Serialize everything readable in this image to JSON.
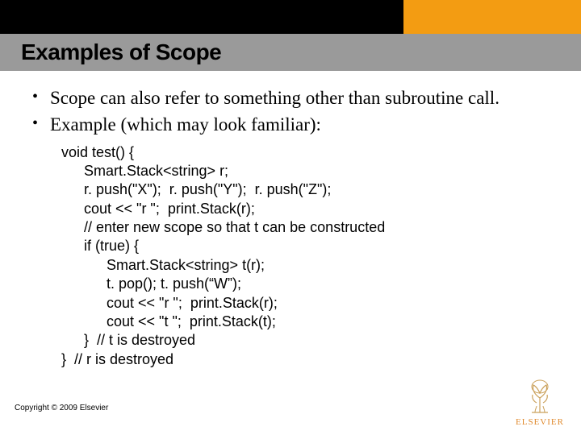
{
  "title": "Examples of Scope",
  "bullets": [
    "Scope can also refer to something other than subroutine call.",
    "Example (which may look familiar):"
  ],
  "code": {
    "l0": "void test() {",
    "l1": "Smart.Stack<string> r;",
    "l2": "r. push(\"X\");  r. push(\"Y\");  r. push(\"Z\");",
    "l3": "cout << \"r \";  print.Stack(r);",
    "l4": "// enter new scope so that t can be constructed",
    "l5": "if (true) {",
    "l6": "Smart.Stack<string> t(r);",
    "l7": "t. pop(); t. push(“W”);",
    "l8": "cout << \"r \";  print.Stack(r);",
    "l9": "cout << \"t \";  print.Stack(t);",
    "l10": "}  // t is destroyed",
    "l11": "}  // r is destroyed"
  },
  "copyright": "Copyright © 2009 Elsevier",
  "logo_text": "ELSEVIER"
}
